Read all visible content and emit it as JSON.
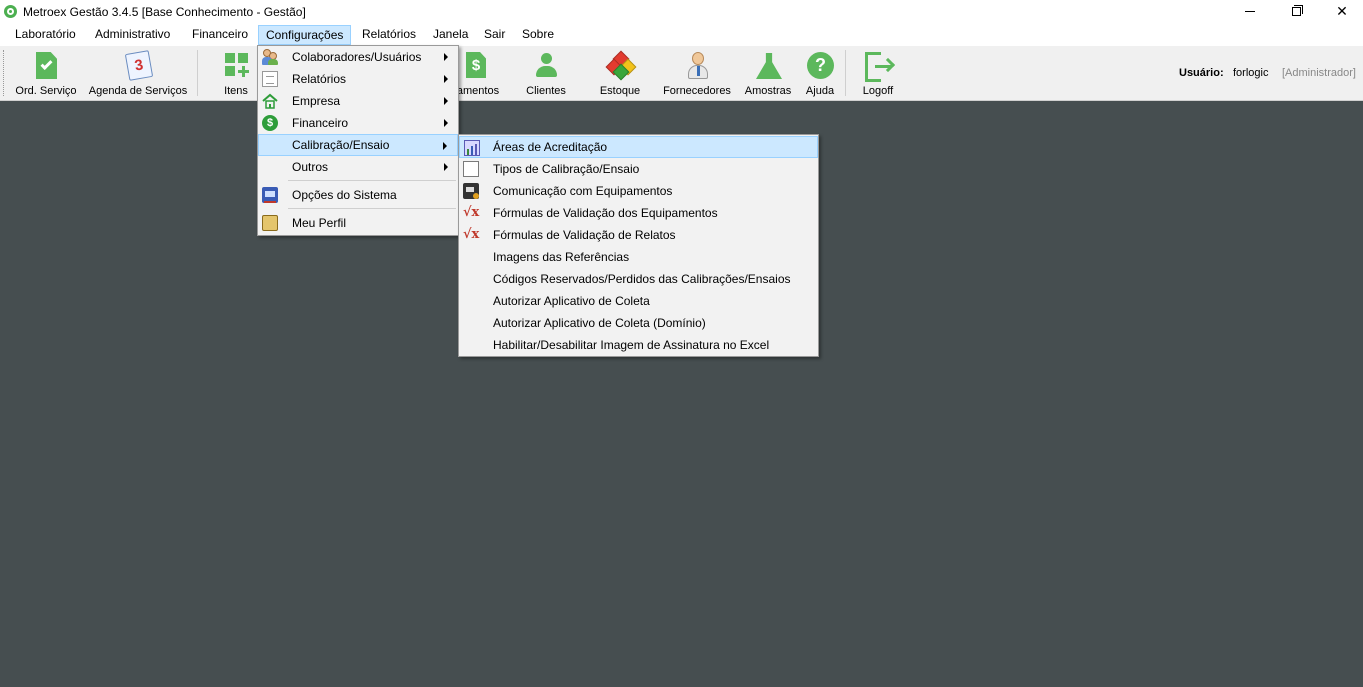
{
  "window": {
    "title": "Metroex Gestão 3.4.5 [Base Conhecimento - Gestão]"
  },
  "menubar": {
    "items": [
      "Laboratório",
      "Administrativo",
      "Financeiro",
      "Configurações",
      "Relatórios",
      "Janela",
      "Sair",
      "Sobre"
    ],
    "active": "Configurações"
  },
  "toolbar": {
    "buttons": [
      "Ord. Serviço",
      "Agenda de Serviços",
      "Itens",
      "amentos",
      "Clientes",
      "Estoque",
      "Fornecedores",
      "Amostras",
      "Ajuda",
      "Logoff"
    ]
  },
  "user": {
    "label": "Usuário:",
    "name": "forlogic",
    "role": "[Administrador]"
  },
  "config_menu": {
    "items": [
      "Colaboradores/Usuários",
      "Relatórios",
      "Empresa",
      "Financeiro",
      "Calibração/Ensaio",
      "Outros",
      "Opções do Sistema",
      "Meu Perfil"
    ],
    "selected": "Calibração/Ensaio"
  },
  "calibracao_submenu": {
    "items": [
      "Áreas de Acreditação",
      "Tipos de Calibração/Ensaio",
      "Comunicação com Equipamentos",
      "Fórmulas de Validação dos Equipamentos",
      "Fórmulas de Validação de Relatos",
      "Imagens das Referências",
      "Códigos Reservados/Perdidos das Calibrações/Ensaios",
      "Autorizar Aplicativo de Coleta",
      "Autorizar Aplicativo de Coleta (Domínio)",
      "Habilitar/Desabilitar Imagem de Assinatura no Excel"
    ],
    "selected": "Áreas de Acreditação"
  },
  "colors": {
    "workspace": "#464e50",
    "accent_green": "#5cb85c",
    "selection": "#cce8ff"
  }
}
